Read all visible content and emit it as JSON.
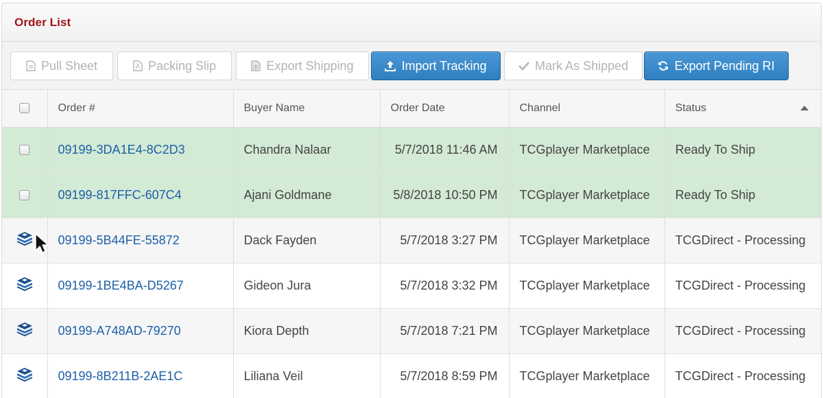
{
  "panel": {
    "title": "Order List"
  },
  "toolbar": {
    "buttons": [
      {
        "label": "Pull Sheet",
        "icon": "document-icon",
        "state": "disabled"
      },
      {
        "label": "Packing Slip",
        "icon": "pdf-icon",
        "state": "disabled"
      },
      {
        "label": "Export Shipping",
        "icon": "spreadsheet-icon",
        "state": "disabled"
      },
      {
        "label": "Import Tracking",
        "icon": "upload-icon",
        "state": "primary"
      },
      {
        "label": "Mark As Shipped",
        "icon": "check-icon",
        "state": "disabled"
      },
      {
        "label": "Export Pending RI",
        "icon": "refresh-icon",
        "state": "primary"
      }
    ]
  },
  "table": {
    "columns": [
      "",
      "Order #",
      "Buyer Name",
      "Order Date",
      "Channel",
      "Status"
    ],
    "sort": {
      "column": "Status",
      "direction": "ascending"
    },
    "rows": [
      {
        "order": "09199-3DA1E4-8C2D3",
        "buyer": "Chandra Nalaar",
        "date": "5/7/2018 11:46 AM",
        "channel": "TCGplayer Marketplace",
        "status": "Ready To Ship",
        "row_icon": "checkbox"
      },
      {
        "order": "09199-817FFC-607C4",
        "buyer": "Ajani Goldmane",
        "date": "5/8/2018 10:50 PM",
        "channel": "TCGplayer Marketplace",
        "status": "Ready To Ship",
        "row_icon": "checkbox"
      },
      {
        "order": "09199-5B44FE-55872",
        "buyer": "Dack Fayden",
        "date": "5/7/2018 3:27 PM",
        "channel": "TCGplayer Marketplace",
        "status": "TCGDirect - Processing",
        "row_icon": "tcgdirect-box-icon"
      },
      {
        "order": "09199-1BE4BA-D5267",
        "buyer": "Gideon Jura",
        "date": "5/7/2018 3:32 PM",
        "channel": "TCGplayer Marketplace",
        "status": "TCGDirect - Processing",
        "row_icon": "tcgdirect-box-icon"
      },
      {
        "order": "09199-A748AD-79270",
        "buyer": "Kiora Depth",
        "date": "5/7/2018 7:21 PM",
        "channel": "TCGplayer Marketplace",
        "status": "TCGDirect - Processing",
        "row_icon": "tcgdirect-box-icon"
      },
      {
        "order": "09199-8B211B-2AE1C",
        "buyer": "Liliana Veil",
        "date": "5/7/2018 8:59 PM",
        "channel": "TCGplayer Marketplace",
        "status": "TCGDirect - Processing",
        "row_icon": "tcgdirect-box-icon"
      }
    ]
  },
  "colors": {
    "title": "#a0151c",
    "link": "#1d5fa8",
    "primary_button": "#337ab7",
    "ready_row": "#d3ead4"
  }
}
